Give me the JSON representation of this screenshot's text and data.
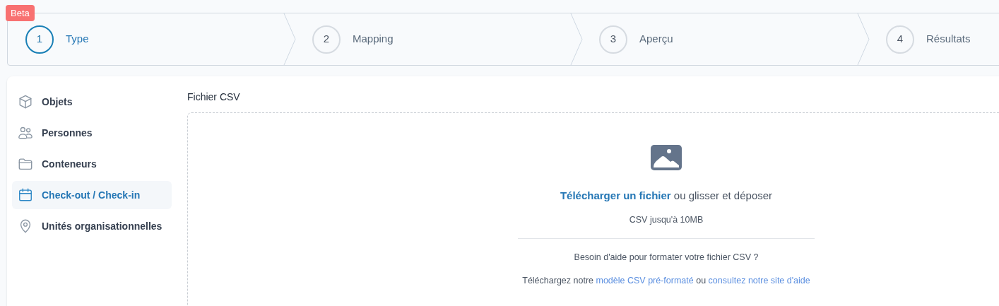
{
  "badge": "Beta",
  "steps": [
    {
      "number": "1",
      "label": "Type",
      "selected": true
    },
    {
      "number": "2",
      "label": "Mapping",
      "selected": false
    },
    {
      "number": "3",
      "label": "Aperçu",
      "selected": false
    },
    {
      "number": "4",
      "label": "Résultats",
      "selected": false
    }
  ],
  "sidebar": {
    "items": [
      {
        "kind": "cube",
        "label": "Objets",
        "selected": false
      },
      {
        "kind": "people",
        "label": "Personnes",
        "selected": false
      },
      {
        "kind": "folder",
        "label": "Conteneurs",
        "selected": false
      },
      {
        "kind": "calendar",
        "label": "Check-out / Check-in",
        "selected": true
      },
      {
        "kind": "pin",
        "label": "Unités organisationnelles",
        "selected": false
      }
    ]
  },
  "upload": {
    "label": "Fichier CSV",
    "prompt": [
      {
        "kind": "link",
        "text": "Télécharger un fichier"
      },
      {
        "kind": "text",
        "text": " ou glisser et déposer"
      }
    ],
    "hint": "CSV jusqu'à 10MB",
    "help_question": "Besoin d'aide pour formater votre fichier CSV ?",
    "help_links": [
      {
        "kind": "text",
        "text": "Téléchargez notre "
      },
      {
        "kind": "link",
        "text": "modèle CSV pré-formaté"
      },
      {
        "kind": "text",
        "text": " ou "
      },
      {
        "kind": "link",
        "text": "consultez notre site d'aide"
      }
    ]
  }
}
